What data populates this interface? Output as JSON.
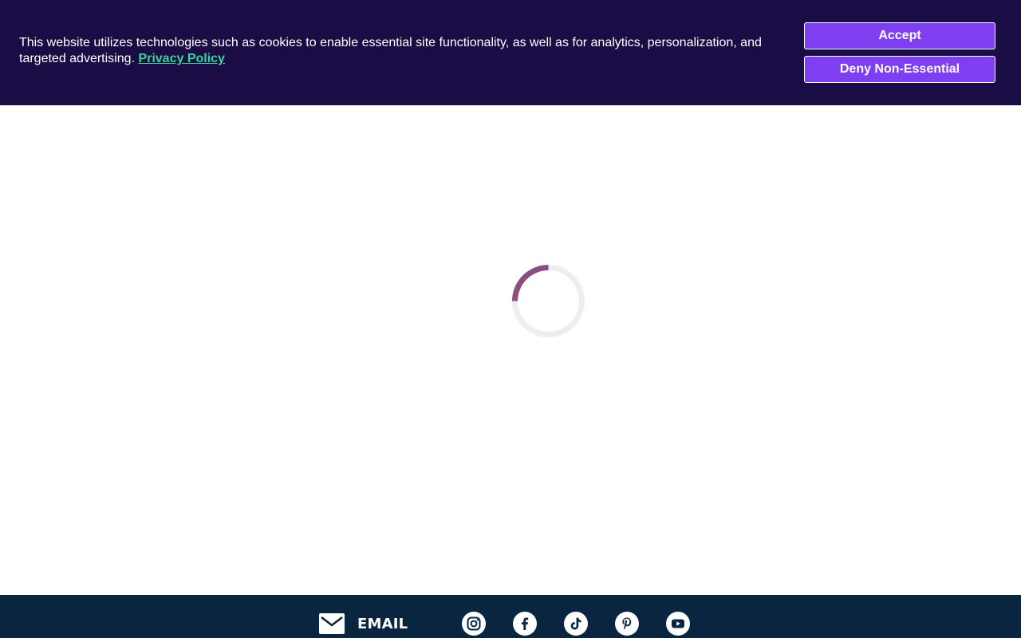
{
  "cookie_banner": {
    "text": "This website utilizes technologies such as cookies to enable essential site functionality, as well as for analytics, personalization, and targeted advertising.",
    "privacy_link": "Privacy Policy",
    "accept_label": "Accept",
    "deny_label": "Deny Non-Essential"
  },
  "footer": {
    "email_label": "EMAIL",
    "social_icons": [
      "instagram-icon",
      "facebook-icon",
      "tiktok-icon",
      "pinterest-icon",
      "youtube-icon"
    ]
  },
  "colors": {
    "banner_bg": "#1a0d45",
    "button_bg": "#7d3ff0",
    "link": "#3ad39b",
    "spinner_arc": "#8a4f7d",
    "spinner_track": "#eeeeee",
    "footer_bg": "#0a2540"
  }
}
